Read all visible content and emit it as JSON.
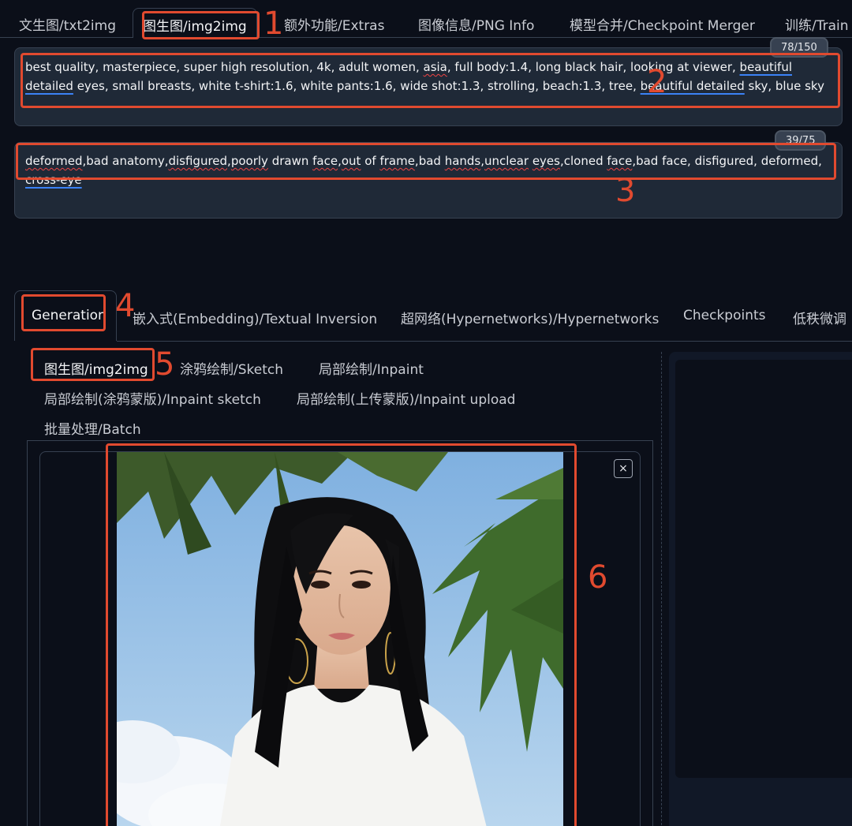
{
  "top_tabs": [
    {
      "label": "文生图/txt2img"
    },
    {
      "label": "图生图/img2img"
    },
    {
      "label": "额外功能/Extras"
    },
    {
      "label": "图像信息/PNG Info"
    },
    {
      "label": "模型合并/Checkpoint Merger"
    },
    {
      "label": "训练/Train"
    }
  ],
  "prompt": {
    "counter": "78/150",
    "segments": [
      {
        "text": "best quality, masterpiece, super high resolution, 4k, adult women, ",
        "style": ""
      },
      {
        "text": "asia",
        "style": "squig"
      },
      {
        "text": ", full body:1.4, long black hair, looking at viewer, ",
        "style": ""
      },
      {
        "text": "beautiful detailed",
        "style": "blueu"
      },
      {
        "text": " eyes, small breasts, white t-shirt:1.6, white pants:1.6, wide shot:1.3, strolling, beach:1.3, tree, ",
        "style": ""
      },
      {
        "text": "beautiful detailed",
        "style": "blueu"
      },
      {
        "text": " sky, blue sky",
        "style": ""
      }
    ]
  },
  "negative_prompt": {
    "counter": "39/75",
    "segments": [
      {
        "text": "deformed",
        "style": "squig"
      },
      {
        "text": ",bad anatomy,",
        "style": ""
      },
      {
        "text": "disfigured",
        "style": "squig"
      },
      {
        "text": ",",
        "style": ""
      },
      {
        "text": "poorly",
        "style": "squig"
      },
      {
        "text": " drawn ",
        "style": ""
      },
      {
        "text": "face",
        "style": "squig"
      },
      {
        "text": ",",
        "style": ""
      },
      {
        "text": "out",
        "style": "squig"
      },
      {
        "text": " of ",
        "style": ""
      },
      {
        "text": "frame",
        "style": "squig"
      },
      {
        "text": ",bad ",
        "style": ""
      },
      {
        "text": "hands",
        "style": "squig"
      },
      {
        "text": ",",
        "style": ""
      },
      {
        "text": "unclear",
        "style": "squig"
      },
      {
        "text": " ",
        "style": ""
      },
      {
        "text": "eyes",
        "style": "squig"
      },
      {
        "text": ",cloned ",
        "style": ""
      },
      {
        "text": "face",
        "style": "squig"
      },
      {
        "text": ",bad face, disfigured, deformed, ",
        "style": ""
      },
      {
        "text": "cross-eye",
        "style": "blueu"
      }
    ]
  },
  "gen_tabs": [
    {
      "label": "Generation"
    },
    {
      "label": "嵌入式(Embedding)/Textual Inversion"
    },
    {
      "label": "超网络(Hypernetworks)/Hypernetworks"
    },
    {
      "label": "Checkpoints"
    },
    {
      "label": "低秩微调"
    }
  ],
  "sub_tabs": [
    {
      "label": "图生图/img2img"
    },
    {
      "label": "涂鸦绘制/Sketch"
    },
    {
      "label": "局部绘制/Inpaint"
    },
    {
      "label": "局部绘制(涂鸦蒙版)/Inpaint sketch"
    },
    {
      "label": "局部绘制(上传蒙版)/Inpaint upload"
    },
    {
      "label": "批量处理/Batch"
    }
  ],
  "close_icon": "×",
  "annotations": [
    "1",
    "2",
    "3",
    "4",
    "5",
    "6"
  ],
  "colors": {
    "annotation": "#e14a2f",
    "background": "#0b0f19",
    "panel": "#1f2937"
  }
}
